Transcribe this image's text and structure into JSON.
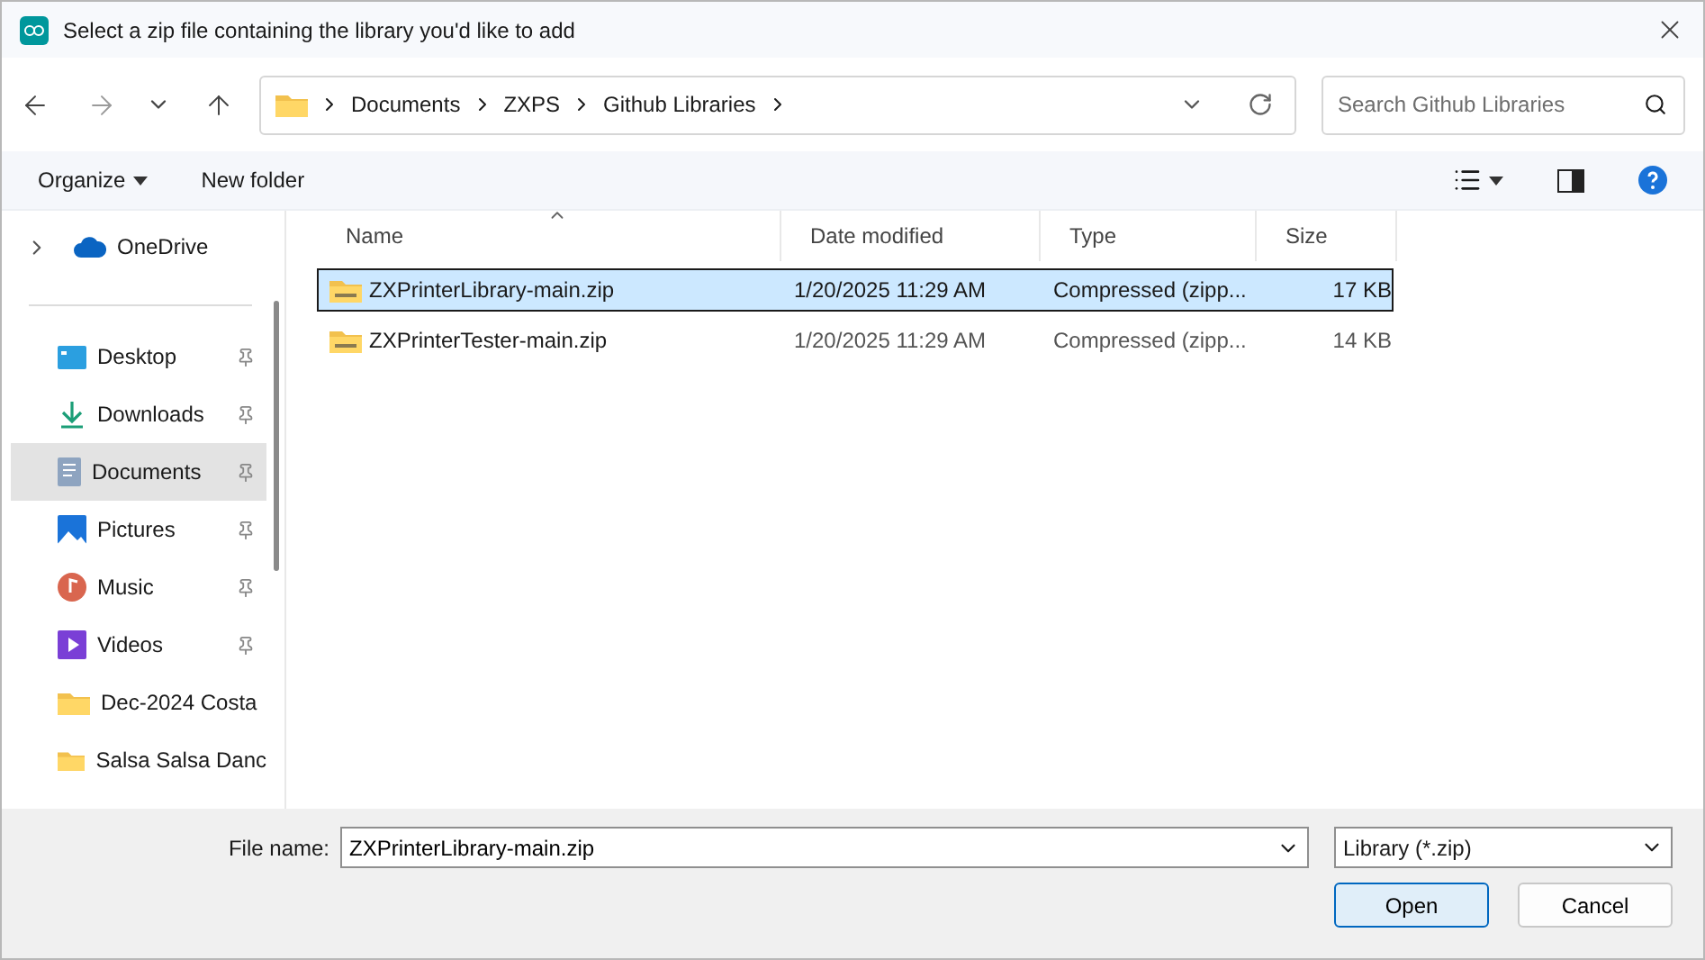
{
  "window": {
    "title": "Select a zip file containing the library you'd like to add"
  },
  "address": {
    "crumbs": [
      "Documents",
      "ZXPS",
      "Github Libraries"
    ]
  },
  "search": {
    "placeholder": "Search Github Libraries"
  },
  "commands": [
    "Organize",
    "New folder"
  ],
  "sidebar": {
    "items": [
      {
        "label": "OneDrive",
        "kind": "cloud",
        "expandable": true,
        "pinned": false,
        "selected": false
      },
      {
        "label": "Desktop",
        "kind": "desktop",
        "expandable": false,
        "pinned": true,
        "selected": false
      },
      {
        "label": "Downloads",
        "kind": "download",
        "expandable": false,
        "pinned": true,
        "selected": false
      },
      {
        "label": "Documents",
        "kind": "document",
        "expandable": false,
        "pinned": true,
        "selected": true
      },
      {
        "label": "Pictures",
        "kind": "picture",
        "expandable": false,
        "pinned": true,
        "selected": false
      },
      {
        "label": "Music",
        "kind": "music",
        "expandable": false,
        "pinned": true,
        "selected": false
      },
      {
        "label": "Videos",
        "kind": "video",
        "expandable": false,
        "pinned": true,
        "selected": false
      },
      {
        "label": "Dec-2024 Costa",
        "kind": "folder",
        "expandable": false,
        "pinned": false,
        "selected": false
      },
      {
        "label": "Salsa Salsa Danc",
        "kind": "folder",
        "expandable": false,
        "pinned": false,
        "selected": false
      }
    ]
  },
  "table": {
    "columns": [
      "Name",
      "Date modified",
      "Type",
      "Size"
    ],
    "rows": [
      {
        "name": "ZXPrinterLibrary-main.zip",
        "date": "1/20/2025 11:29 AM",
        "type": "Compressed (zipp...",
        "size": "17 KB",
        "selected": true
      },
      {
        "name": "ZXPrinterTester-main.zip",
        "date": "1/20/2025 11:29 AM",
        "type": "Compressed (zipp...",
        "size": "14 KB",
        "selected": false
      }
    ]
  },
  "file_name": {
    "label": "File name:",
    "value": "ZXPrinterLibrary-main.zip"
  },
  "filter": {
    "value": "Library (*.zip)"
  },
  "buttons": [
    "Open",
    "Cancel"
  ]
}
